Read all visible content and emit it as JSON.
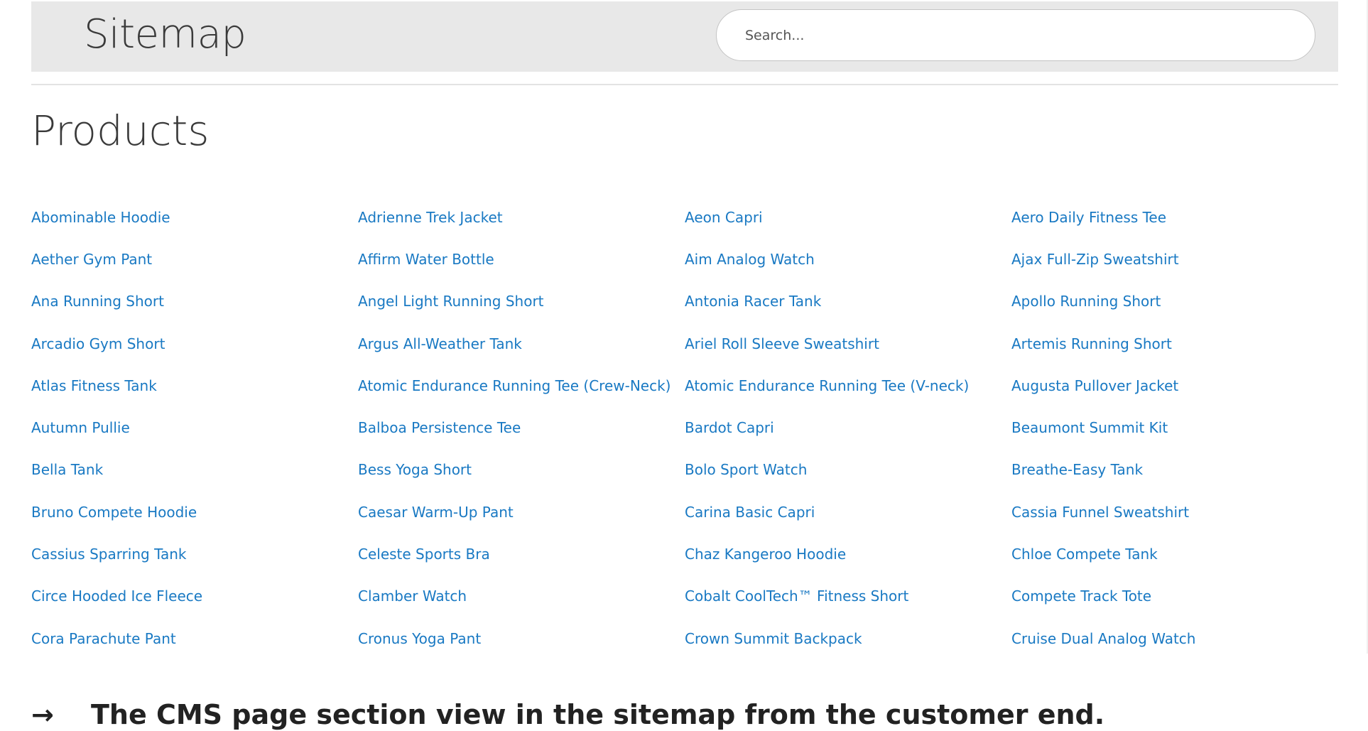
{
  "header": {
    "title": "Sitemap",
    "search_placeholder": "Search..."
  },
  "products_section": {
    "title": "Products",
    "items": [
      "Abominable Hoodie",
      "Adrienne Trek Jacket",
      "Aeon Capri",
      "Aero Daily Fitness Tee",
      "Aether Gym Pant",
      "Affirm Water Bottle",
      "Aim Analog Watch",
      "Ajax Full-Zip Sweatshirt",
      "Ana Running Short",
      "Angel Light Running Short",
      "Antonia Racer Tank",
      "Apollo Running Short",
      "Arcadio Gym Short",
      "Argus All-Weather Tank",
      "Ariel Roll Sleeve Sweatshirt",
      "Artemis Running Short",
      "Atlas Fitness Tank",
      "Atomic Endurance Running Tee (Crew-Neck)",
      "Atomic Endurance Running Tee (V-neck)",
      "Augusta Pullover Jacket",
      "Autumn Pullie",
      "Balboa Persistence Tee",
      "Bardot Capri",
      "Beaumont Summit Kit",
      "Bella Tank",
      "Bess Yoga Short",
      "Bolo Sport Watch",
      "Breathe-Easy Tank",
      "Bruno Compete Hoodie",
      "Caesar Warm-Up Pant",
      "Carina Basic Capri",
      "Cassia Funnel Sweatshirt",
      "Cassius Sparring Tank",
      "Celeste Sports Bra",
      "Chaz Kangeroo Hoodie",
      "Chloe Compete Tank",
      "Circe Hooded Ice Fleece",
      "Clamber Watch",
      "Cobalt CoolTech™ Fitness Short",
      "Compete Track Tote",
      "Cora Parachute Pant",
      "Cronus Yoga Pant",
      "Crown Summit Backpack",
      "Cruise Dual Analog Watch"
    ]
  },
  "caption": {
    "arrow": "→",
    "text": "The CMS page section view in the sitemap from the customer end."
  },
  "colors": {
    "link": "#1979c3",
    "header_bg": "#e8e8e8",
    "heading_text": "#3a3a3a"
  }
}
